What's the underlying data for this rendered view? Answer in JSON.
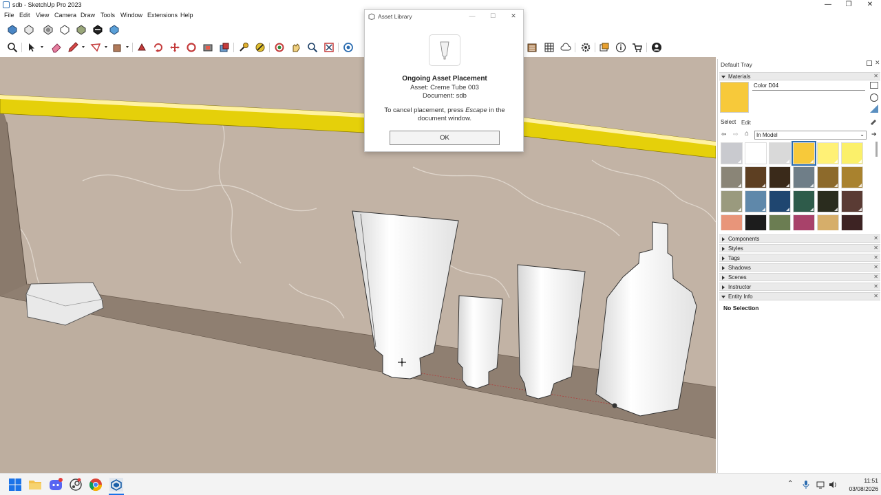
{
  "window": {
    "title": "sdb - SketchUp Pro 2023",
    "minimize_glyph": "—",
    "maximize_glyph": "❐",
    "close_glyph": "✕"
  },
  "menu": [
    "File",
    "Edit",
    "View",
    "Camera",
    "Draw",
    "Tools",
    "Window",
    "Extensions",
    "Help"
  ],
  "toolbar_icons_row1": [
    "solid-tools-union-icon",
    "solid-tools-outer-shell-icon",
    "solid-tools-intersect-icon",
    "solid-tools-subtract-icon",
    "solid-tools-trim-icon",
    "solid-tools-split-icon",
    "x-ray-icon"
  ],
  "toolbar_icons_row2": [
    "zoom-icon",
    "select-icon",
    "eraser-icon",
    "pencil-icon",
    "shape-icon",
    "push-pull-icon",
    "follow-me-icon",
    "rotate-icon",
    "move-icon",
    "scale-icon",
    "paint-bucket-icon",
    "offset-icon",
    "tape-measure-icon",
    "protractor-icon",
    "orbit-icon",
    "pan-icon",
    "zoom-window-icon",
    "zoom-extents-icon",
    "section-plane-icon",
    "3d-warehouse-icon",
    "sandbox-icon",
    "warehouse-cloud-icon",
    "extension-manager-icon",
    "layout-icon",
    "information-icon",
    "extension-warehouse-icon",
    "account-icon"
  ],
  "dialog": {
    "title": "Asset Library",
    "heading": "Ongoing Asset Placement",
    "asset_line": "Asset: Creme Tube 003",
    "document_line": "Document: sdb",
    "cancel_line_1_a": "To cancel placement, press ",
    "cancel_line_1_key": "Escape",
    "cancel_line_1_b": " in the",
    "cancel_line_2": "document window.",
    "ok_label": "OK",
    "minimize_glyph": "—",
    "maximize_glyph": "☐",
    "close_glyph": "✕"
  },
  "tray": {
    "title": "Default Tray",
    "materials": {
      "section_label": "Materials",
      "current_material": "Color D04",
      "current_color": "#f7c93a",
      "tab_select": "Select",
      "tab_edit": "Edit",
      "collection": "In Model",
      "swatches": [
        "#c9cacf",
        "#ffffff",
        "#d9d9d9",
        "#f7c93a",
        "#fff176",
        "#fbf06a",
        "#8a8577",
        "#5d3f22",
        "#3a2a1a",
        "#6f7e88",
        "#8d6a2b",
        "#a9822e",
        "#9a9a7e",
        "#5f88aa",
        "#1f4670",
        "#2e5b4a",
        "#2a2c1e",
        "#5a3b34",
        "#e8957a",
        "#1c1c1c",
        "#6b7d52",
        "#a8426a",
        "#d6ae6a",
        "#3d2323"
      ]
    },
    "sections": [
      "Components",
      "Styles",
      "Tags",
      "Shadows",
      "Scenes",
      "Instructor"
    ],
    "entity_info": {
      "label": "Entity Info",
      "value": "No Selection"
    }
  },
  "taskbar": {
    "time": "11:51",
    "date": "03/08/2026",
    "apps": [
      "windows-start-icon",
      "file-explorer-icon",
      "discord-icon",
      "steam-icon",
      "chrome-icon",
      "sketchup-icon"
    ],
    "tray_icons": [
      "chevron-up-icon",
      "microphone-icon",
      "network-icon",
      "volume-icon"
    ]
  }
}
